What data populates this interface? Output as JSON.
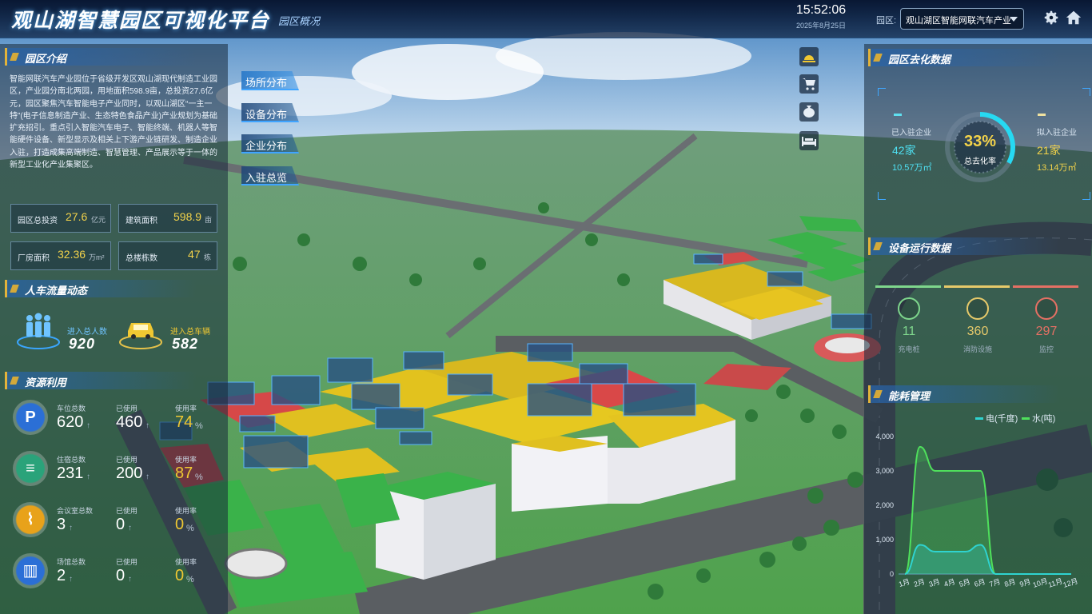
{
  "header": {
    "title": "观山湖智慧园区可视化平台",
    "subtitle": "园区概况",
    "time": "15:52:06",
    "date": "2025年8月25日",
    "park_label": "园区:",
    "park_selected": "观山湖区智能网联汽车产业"
  },
  "menu": [
    "场所分布",
    "设备分布",
    "企业分布",
    "入驻总览"
  ],
  "intro": {
    "title": "园区介绍",
    "text": "智能网联汽车产业园位于省级开发区观山湖现代制造工业园区，产业园分南北两园，用地面积598.9亩，总投资27.6亿元，园区聚焦汽车智能电子产业同时，以观山湖区“一主一特”(电子信息制造产业、生态特色食品产业)产业规划为基础扩充招引。重点引入智能汽车电子、智能终端、机器人等智能硬件设备、新型显示及相关上下游产业链研发、制造企业入驻，打造成集高端制造、智慧管理、产品展示等于一体的新型工业化产业集聚区。",
    "stats": [
      {
        "label": "园区总投资",
        "value": "27.6",
        "unit": "亿元"
      },
      {
        "label": "建筑面积",
        "value": "598.9",
        "unit": "亩"
      },
      {
        "label": "厂房面积",
        "value": "32.36",
        "unit": "万m²"
      },
      {
        "label": "总楼栋数",
        "value": "47",
        "unit": "栋"
      }
    ]
  },
  "flow": {
    "title": "人车流量动态",
    "people_label": "进入总人数",
    "people_value": "920",
    "vehicle_label": "进入总车辆",
    "vehicle_value": "582"
  },
  "resources": {
    "title": "资源利用",
    "used_label": "已使用",
    "rate_label": "使用率",
    "items": [
      {
        "icon": "parking-icon",
        "total_label": "车位总数",
        "total": "620",
        "used": "460",
        "rate": "74"
      },
      {
        "icon": "bed-icon",
        "total_label": "住宿总数",
        "total": "231",
        "used": "200",
        "rate": "87"
      },
      {
        "icon": "meeting-icon",
        "total_label": "会议室总数",
        "total": "3",
        "used": "0",
        "rate": "0"
      },
      {
        "icon": "venue-icon",
        "total_label": "场馆总数",
        "total": "2",
        "used": "0",
        "rate": "0"
      }
    ]
  },
  "occupancy": {
    "title": "园区去化数据",
    "left_label": "已入驻企业",
    "left_count": "42家",
    "left_area": "10.57万㎡",
    "right_label": "拟入驻企业",
    "right_count": "21家",
    "right_area": "13.14万㎡",
    "rate": "33%",
    "rate_label": "总去化率",
    "rate_value": 0.33
  },
  "devices": {
    "title": "设备运行数据",
    "items": [
      {
        "icon": "charger-icon",
        "value": "11",
        "label": "充电桩",
        "color": "#7ed68c"
      },
      {
        "icon": "fire-icon",
        "value": "360",
        "label": "消防设施",
        "color": "#e6c96a"
      },
      {
        "icon": "camera-icon",
        "value": "297",
        "label": "监控",
        "color": "#e57064"
      }
    ]
  },
  "energy": {
    "title": "能耗管理"
  },
  "chart_data": {
    "type": "area",
    "categories": [
      "1月",
      "2月",
      "3月",
      "4月",
      "5月",
      "6月",
      "7月",
      "8月",
      "9月",
      "10月",
      "11月",
      "12月"
    ],
    "series": [
      {
        "name": "电(千度)",
        "color": "#2fd3d0",
        "values": [
          0,
          850,
          650,
          650,
          650,
          850,
          0,
          0,
          0,
          0,
          0,
          0
        ]
      },
      {
        "name": "水(吨)",
        "color": "#4fe05c",
        "values": [
          0,
          3700,
          3000,
          3000,
          3000,
          3000,
          0,
          0,
          0,
          0,
          0,
          0
        ]
      }
    ],
    "yticks": [
      "0",
      "1,000",
      "2,000",
      "3,000",
      "4,000"
    ],
    "ylim": [
      0,
      4000
    ]
  },
  "colors": {
    "accent": "#f3d34a",
    "cyan": "#2fd3f0",
    "water": "#4fe05c"
  }
}
